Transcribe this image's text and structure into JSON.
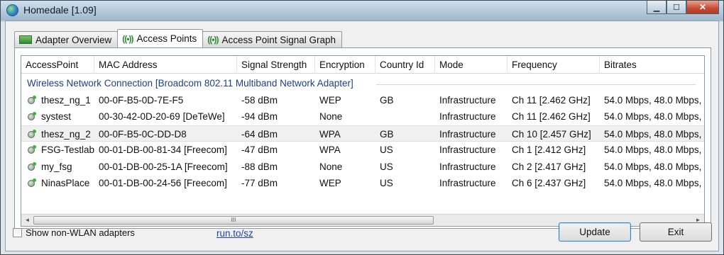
{
  "window": {
    "title": "Homedale [1.09]",
    "controls": {
      "minimize": "▁",
      "maximize": "☐",
      "close": "✕"
    }
  },
  "tabs": [
    {
      "label": "Adapter Overview",
      "active": false,
      "icon": "adapter-icon"
    },
    {
      "label": "Access Points",
      "active": true,
      "icon": "access-point-icon"
    },
    {
      "label": "Access Point Signal Graph",
      "active": false,
      "icon": "access-point-icon"
    }
  ],
  "tab_icon_glyph": "((•))",
  "table": {
    "columns": [
      "AccessPoint",
      "MAC Address",
      "Signal Strength",
      "Encryption",
      "Country Id",
      "Mode",
      "Frequency",
      "Bitrates"
    ],
    "group": "Wireless Network Connection [Broadcom 802.11 Multiband Network Adapter]",
    "rows": [
      [
        "thesz_ng_1",
        "00-0F-B5-0D-7E-F5",
        "-58 dBm",
        "WEP",
        "GB",
        "Infrastructure",
        "Ch 11 [2.462 GHz]",
        "54.0 Mbps, 48.0 Mbps,"
      ],
      [
        "systest",
        "00-30-42-0D-20-69 [DeTeWe]",
        "-94 dBm",
        "None",
        "",
        "Infrastructure",
        "Ch 11 [2.462 GHz]",
        "54.0 Mbps, 48.0 Mbps,"
      ],
      [
        "thesz_ng_2",
        "00-0F-B5-0C-DD-D8",
        "-64 dBm",
        "WPA",
        "GB",
        "Infrastructure",
        "Ch 10 [2.457 GHz]",
        "54.0 Mbps, 48.0 Mbps,"
      ],
      [
        "FSG-Testlab",
        "00-01-DB-00-81-34 [Freecom]",
        "-47 dBm",
        "WPA",
        "US",
        "Infrastructure",
        "Ch 1 [2.412 GHz]",
        "54.0 Mbps, 48.0 Mbps,"
      ],
      [
        "my_fsg",
        "00-01-DB-00-25-1A [Freecom]",
        "-88 dBm",
        "None",
        "US",
        "Infrastructure",
        "Ch 2 [2.417 GHz]",
        "54.0 Mbps, 48.0 Mbps,"
      ],
      [
        "NinasPlace",
        "00-01-DB-00-24-56 [Freecom]",
        "-77 dBm",
        "WEP",
        "US",
        "Infrastructure",
        "Ch 6 [2.437 GHz]",
        "54.0 Mbps, 48.0 Mbps,"
      ]
    ],
    "selected_row": 2
  },
  "scrollbar": {
    "left": "◄",
    "right": "►",
    "grip": "III"
  },
  "footer": {
    "checkbox_label": "Show non-WLAN adapters",
    "checkbox_checked": false,
    "link": "run.to/sz",
    "update_label": "Update",
    "exit_label": "Exit"
  },
  "colors": {
    "link": "#1f3fb4",
    "group_title": "#1e3f8a",
    "signal_icon": "#36b536"
  }
}
